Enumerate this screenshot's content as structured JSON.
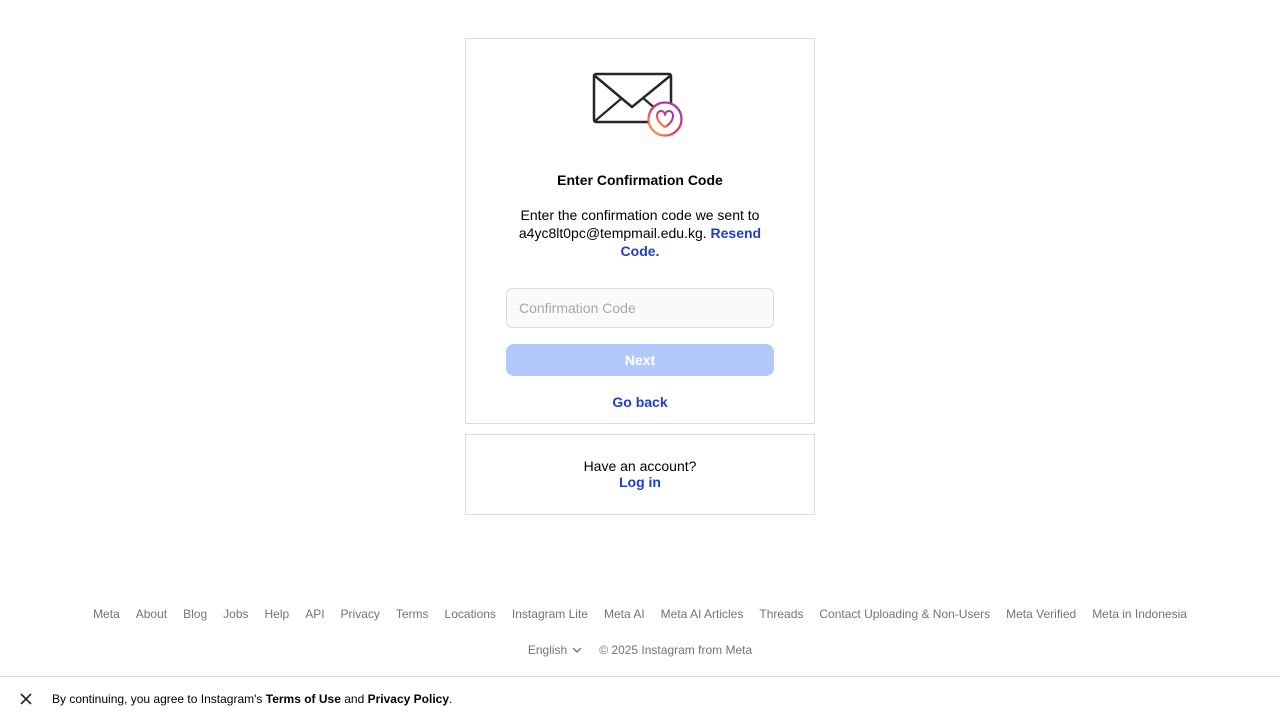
{
  "card": {
    "title": "Enter Confirmation Code",
    "description_prefix": "Enter the confirmation code we sent to a4yc8lt0pc@tempmail.edu.kg.",
    "resend_link": "Resend Code.",
    "input_placeholder": "Confirmation Code",
    "input_value": "",
    "next_label": "Next",
    "go_back_label": "Go back",
    "icons": [
      "envelope-icon",
      "heart-badge-icon"
    ]
  },
  "login_card": {
    "question": "Have an account?",
    "login_link": "Log in"
  },
  "footer": {
    "links": [
      "Meta",
      "About",
      "Blog",
      "Jobs",
      "Help",
      "API",
      "Privacy",
      "Terms",
      "Locations",
      "Instagram Lite",
      "Meta AI",
      "Meta AI Articles",
      "Threads",
      "Contact Uploading & Non-Users",
      "Meta Verified",
      "Meta in Indonesia"
    ],
    "language": "English",
    "copyright": "© 2025 Instagram from Meta"
  },
  "consent": {
    "prefix": "By continuing, you agree to Instagram's",
    "terms": "Terms of Use",
    "and": "and",
    "privacy": "Privacy Policy",
    "suffix": "."
  },
  "colors": {
    "link_blue": "#1e40c8",
    "button_disabled": "#b3c8fd",
    "border": "#dbdbdb",
    "muted_text": "#737373"
  }
}
